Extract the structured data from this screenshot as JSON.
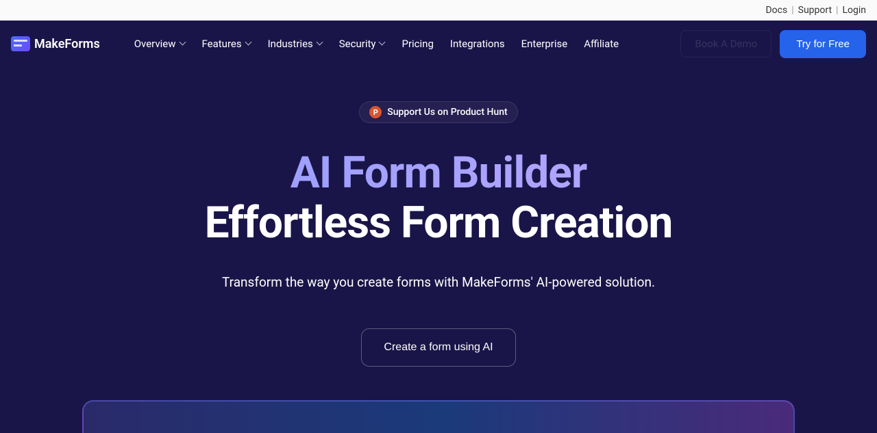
{
  "topbar": {
    "docs": "Docs",
    "support": "Support",
    "login": "Login"
  },
  "logo": {
    "text": "MakeForms"
  },
  "nav": {
    "overview": "Overview",
    "features": "Features",
    "industries": "Industries",
    "security": "Security",
    "pricing": "Pricing",
    "integrations": "Integrations",
    "enterprise": "Enterprise",
    "affiliate": "Affiliate"
  },
  "actions": {
    "book_demo": "Book A Demo",
    "try_free": "Try for Free"
  },
  "hero": {
    "ph_badge": "Support Us on Product Hunt",
    "ph_letter": "P",
    "title_line1": "AI Form Builder",
    "title_line2": "Effortless Form Creation",
    "subtitle": "Transform the way you create forms with MakeForms' AI-powered solution.",
    "cta": "Create a form using AI"
  }
}
